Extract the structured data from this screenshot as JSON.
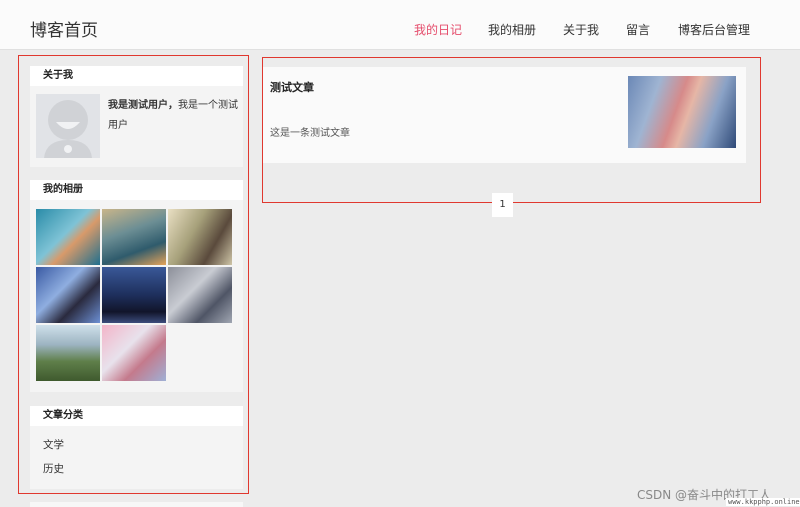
{
  "brand": "博客首页",
  "nav": {
    "items": [
      "我的日记",
      "我的相册",
      "关于我",
      "留言",
      "博客后台管理"
    ],
    "active": 0,
    "active_color": "#e54d6c"
  },
  "sidebar": {
    "about": {
      "title": "关于我",
      "name": "我是测试用户，",
      "bio": "我是一个测试用户"
    },
    "album": {
      "title": "我的相册",
      "photo_count": 8
    },
    "categories": {
      "title": "文章分类",
      "items": [
        "文学",
        "历史"
      ]
    }
  },
  "main": {
    "articles": [
      {
        "title": "测试文章",
        "summary": "这是一条测试文章"
      }
    ],
    "pagination": {
      "current": "1"
    }
  },
  "watermark": {
    "line1": "CSDN @奋斗中的打工人",
    "line2": "www.kkpphp.online"
  },
  "colors": {
    "highlight_frame": "#e0382f",
    "page_bg": "#ececec"
  }
}
